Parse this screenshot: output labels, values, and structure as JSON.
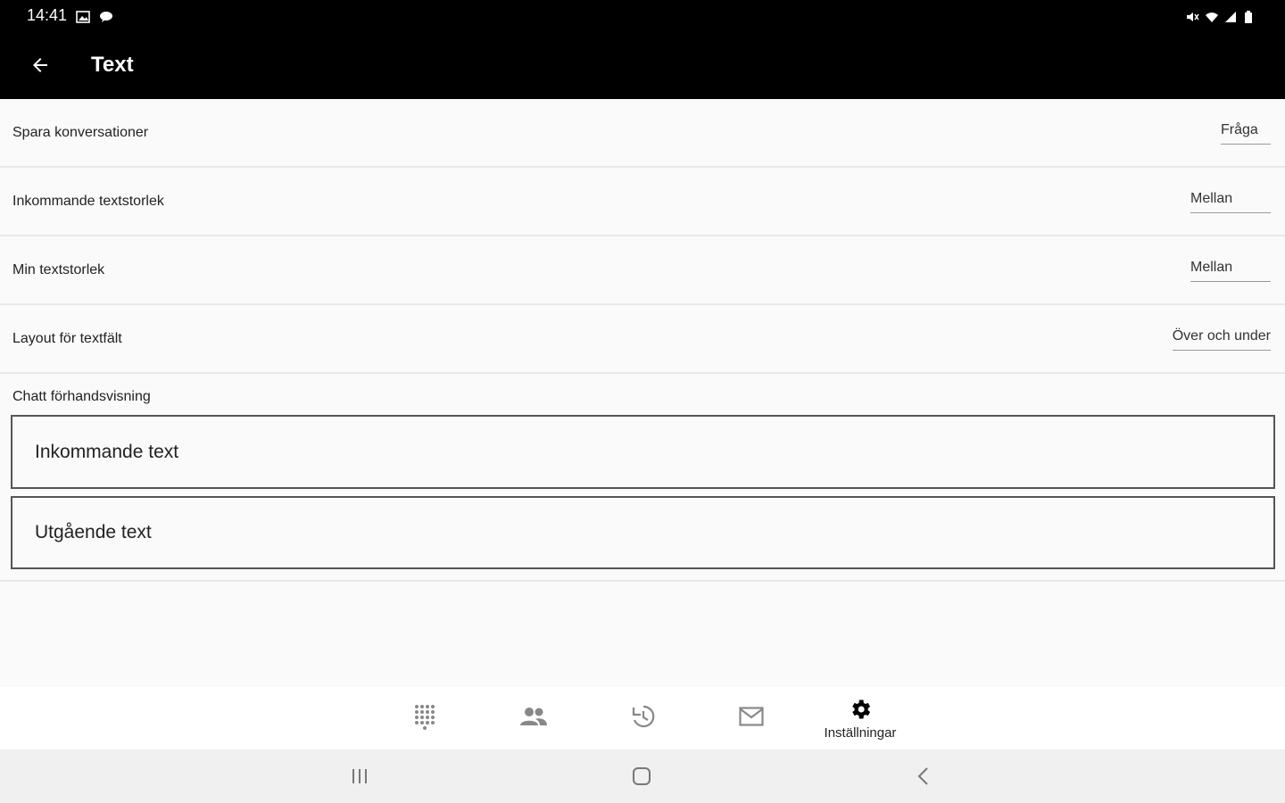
{
  "status_bar": {
    "time": "14:41",
    "left_icons": [
      "gallery-icon",
      "message-bubble-icon"
    ],
    "right_icons": [
      "mute-icon",
      "wifi-icon",
      "signal-icon",
      "battery-icon"
    ]
  },
  "app_bar": {
    "title": "Text",
    "back_icon": "arrow-back-icon"
  },
  "settings": [
    {
      "label": "Spara konversationer",
      "value": "Fråga"
    },
    {
      "label": "Inkommande textstorlek",
      "value": "Mellan"
    },
    {
      "label": "Min textstorlek",
      "value": "Mellan"
    },
    {
      "label": "Layout för textfält",
      "value": "Över och under"
    }
  ],
  "preview": {
    "label": "Chatt förhandsvisning",
    "incoming": "Inkommande text",
    "outgoing": "Utgående text"
  },
  "bottom_nav": {
    "items": [
      {
        "icon": "dialpad-icon",
        "label": ""
      },
      {
        "icon": "contacts-icon",
        "label": ""
      },
      {
        "icon": "history-icon",
        "label": ""
      },
      {
        "icon": "mail-icon",
        "label": ""
      },
      {
        "icon": "gear-icon",
        "label": "Inställningar",
        "active": true
      }
    ]
  },
  "system_nav": [
    "recents-icon",
    "home-icon",
    "back-chevron-icon"
  ],
  "colors": {
    "bar_background": "#000000",
    "content_background": "#fafafa",
    "divider": "#e9e9e9",
    "preview_border": "#555555"
  }
}
